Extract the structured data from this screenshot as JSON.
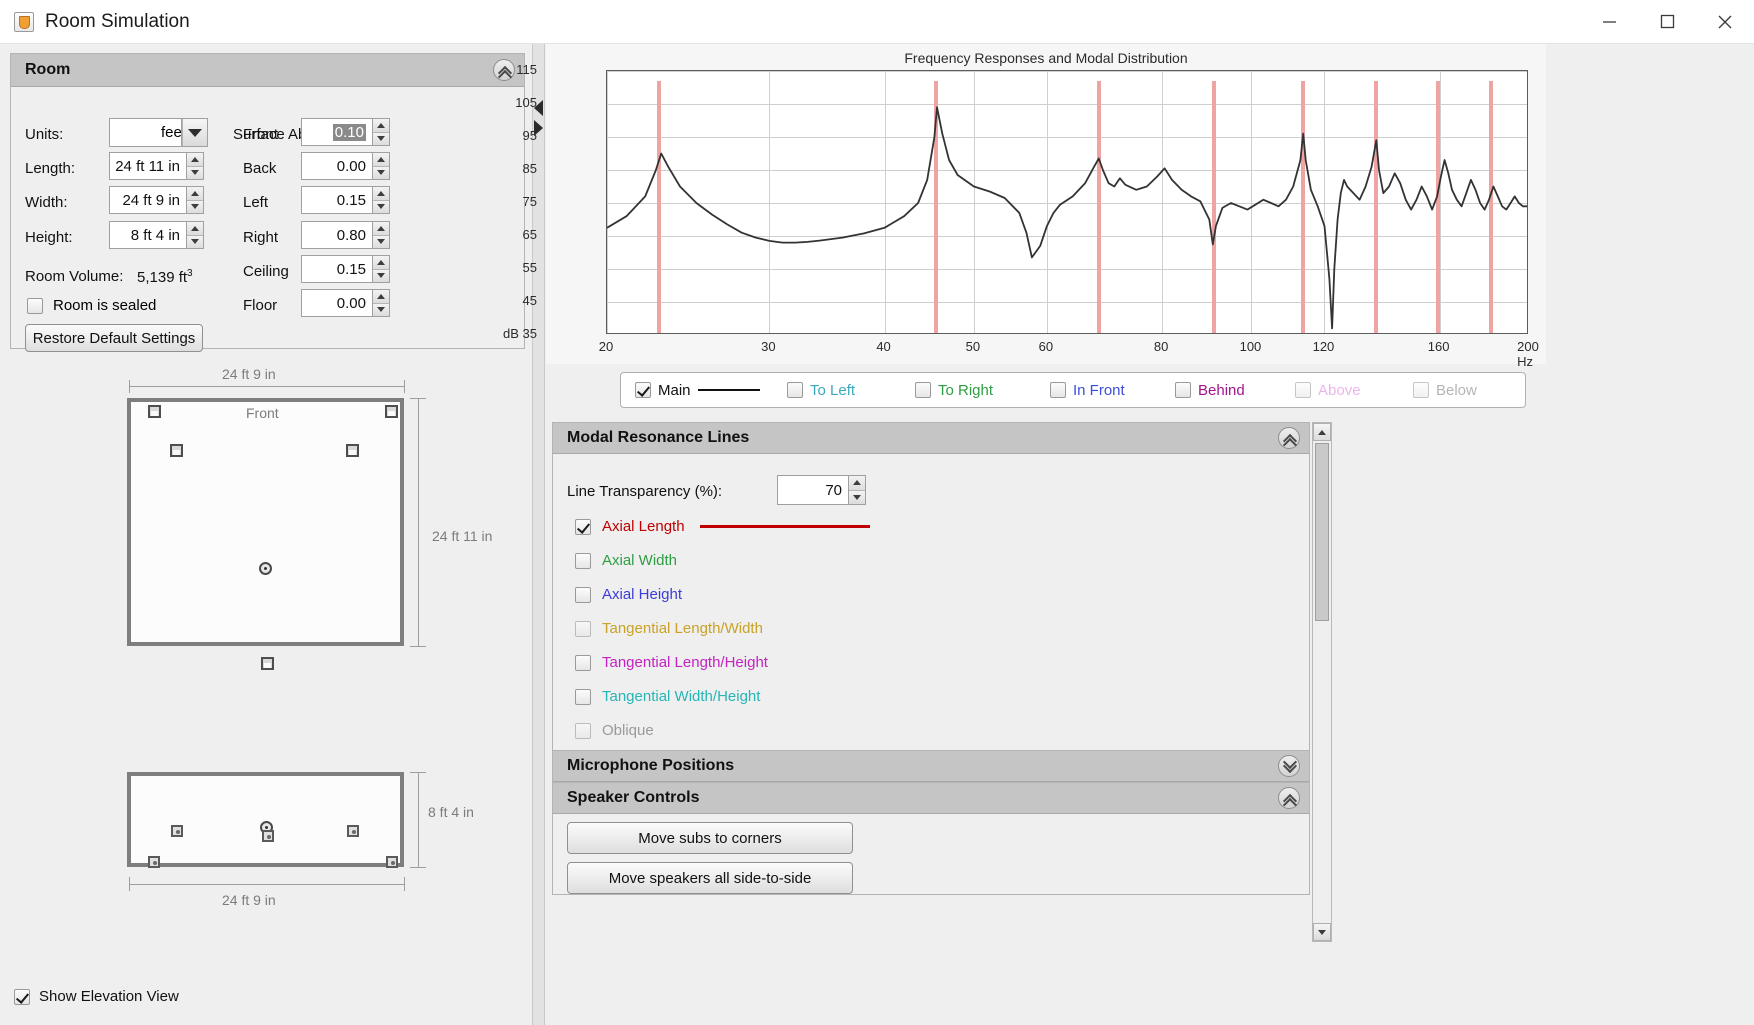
{
  "window": {
    "title": "Room Simulation",
    "icon": "java-coffee-icon",
    "minimize": "minimize-icon",
    "maximize": "maximize-icon",
    "close": "close-icon"
  },
  "room_panel": {
    "title": "Room",
    "collapse_icon": "chevron-up-icon",
    "units_label": "Units:",
    "units_value": "feet",
    "length_label": "Length:",
    "length_value": "24 ft 11 in",
    "width_label": "Width:",
    "width_value": "24 ft 9 in",
    "height_label": "Height:",
    "height_value": "8 ft 4 in",
    "volume_label": "Room Volume:",
    "volume_value": "5,139 ft",
    "volume_exp": "3",
    "sealed_label": "Room is sealed",
    "sealed_checked": false,
    "restore_label": "Restore Default Settings",
    "absorptions_title": "Surface Absorptions",
    "absorptions": [
      {
        "label": "Front",
        "value": "0.10",
        "selected": true
      },
      {
        "label": "Back",
        "value": "0.00",
        "selected": false
      },
      {
        "label": "Left",
        "value": "0.15",
        "selected": false
      },
      {
        "label": "Right",
        "value": "0.80",
        "selected": false
      },
      {
        "label": "Ceiling",
        "value": "0.15",
        "selected": false
      },
      {
        "label": "Floor",
        "value": "0.00",
        "selected": false
      }
    ]
  },
  "room_views": {
    "plan_top_dim": "24 ft 9 in",
    "plan_right_dim": "24 ft 11 in",
    "front_label": "Front",
    "elev_right_dim": "8 ft 4 in",
    "elev_bottom_dim": "24 ft 9 in",
    "show_elevation_label": "Show Elevation View",
    "show_elevation_checked": true
  },
  "chart_data": {
    "type": "line",
    "title": "Frequency Responses and Modal Distribution",
    "xlabel": "Hz",
    "ylabel": "dB",
    "xscale": "log",
    "xlim": [
      20,
      200
    ],
    "ylim": [
      35,
      115
    ],
    "yticks": [
      115,
      105,
      95,
      85,
      75,
      65,
      55,
      45,
      35
    ],
    "ytick_labels": [
      "115",
      "105",
      "95",
      "85",
      "75",
      "65",
      "55",
      "45",
      "dB 35"
    ],
    "xticks": [
      20,
      30,
      40,
      50,
      60,
      80,
      100,
      120,
      160,
      200
    ],
    "xtick_labels": [
      "20",
      "30",
      "40",
      "50",
      "60",
      "80",
      "100",
      "120",
      "160",
      "200 Hz"
    ],
    "grid": true,
    "legend_position": "below",
    "modal_lines_label": "Axial Length resonances",
    "modal_lines_color": "#f0a3a3",
    "modal_lines_hz": [
      22.8,
      45.5,
      68.3,
      91.0,
      113.8,
      136.6,
      159.3,
      182.1
    ],
    "series": [
      {
        "name": "Main",
        "color": "#333333",
        "points_hz_db": [
          [
            20,
            67.5
          ],
          [
            21,
            71
          ],
          [
            22,
            77
          ],
          [
            22.6,
            85
          ],
          [
            22.9,
            90
          ],
          [
            23.3,
            86
          ],
          [
            24,
            80
          ],
          [
            25,
            75
          ],
          [
            26,
            71.5
          ],
          [
            27,
            68.5
          ],
          [
            28,
            66
          ],
          [
            29,
            64.5
          ],
          [
            30,
            63.5
          ],
          [
            31,
            63
          ],
          [
            32,
            63
          ],
          [
            33,
            63.2
          ],
          [
            34,
            63.6
          ],
          [
            36,
            64.5
          ],
          [
            38,
            65.8
          ],
          [
            40,
            67.5
          ],
          [
            42,
            71
          ],
          [
            43.5,
            75
          ],
          [
            44.5,
            82
          ],
          [
            45.3,
            95
          ],
          [
            45.6,
            104
          ],
          [
            46.2,
            96
          ],
          [
            47,
            88
          ],
          [
            48,
            83.5
          ],
          [
            50,
            80
          ],
          [
            52,
            78.5
          ],
          [
            54,
            76.5
          ],
          [
            56,
            72
          ],
          [
            57,
            66
          ],
          [
            57.8,
            58.5
          ],
          [
            59,
            62
          ],
          [
            60,
            68
          ],
          [
            61,
            72
          ],
          [
            62,
            74.5
          ],
          [
            64,
            77
          ],
          [
            66,
            81
          ],
          [
            67.5,
            86
          ],
          [
            68.3,
            88.5
          ],
          [
            69,
            85
          ],
          [
            70,
            81
          ],
          [
            71,
            80
          ],
          [
            72,
            82.5
          ],
          [
            73,
            80.5
          ],
          [
            75,
            79
          ],
          [
            77,
            80
          ],
          [
            79,
            83
          ],
          [
            80.5,
            85.5
          ],
          [
            82,
            82
          ],
          [
            84,
            79
          ],
          [
            86,
            77
          ],
          [
            88,
            75.5
          ],
          [
            90,
            70
          ],
          [
            90.8,
            62.5
          ],
          [
            91.5,
            68
          ],
          [
            93,
            73.5
          ],
          [
            95,
            75
          ],
          [
            97,
            74
          ],
          [
            99,
            73
          ],
          [
            101,
            74.5
          ],
          [
            103,
            76
          ],
          [
            105,
            75
          ],
          [
            107,
            74
          ],
          [
            109,
            76
          ],
          [
            111,
            80
          ],
          [
            113,
            88
          ],
          [
            113.8,
            96
          ],
          [
            114.5,
            88
          ],
          [
            116,
            79
          ],
          [
            118,
            74
          ],
          [
            120,
            68
          ],
          [
            121.5,
            52
          ],
          [
            122.3,
            37
          ],
          [
            123,
            55
          ],
          [
            124,
            70
          ],
          [
            125,
            78
          ],
          [
            126,
            82
          ],
          [
            127,
            80
          ],
          [
            129,
            78
          ],
          [
            131,
            76
          ],
          [
            133,
            80
          ],
          [
            135,
            86
          ],
          [
            136.6,
            94
          ],
          [
            137.5,
            85
          ],
          [
            139,
            78
          ],
          [
            141,
            80
          ],
          [
            143,
            84
          ],
          [
            145,
            81
          ],
          [
            147,
            76
          ],
          [
            149,
            73
          ],
          [
            151,
            76
          ],
          [
            153,
            80
          ],
          [
            155,
            77
          ],
          [
            157,
            73
          ],
          [
            159,
            77
          ],
          [
            160.5,
            83
          ],
          [
            162,
            88
          ],
          [
            163.5,
            84
          ],
          [
            165,
            79
          ],
          [
            167,
            76
          ],
          [
            169,
            74
          ],
          [
            171,
            78
          ],
          [
            173,
            82
          ],
          [
            175,
            79
          ],
          [
            177,
            75
          ],
          [
            179,
            73
          ],
          [
            181,
            76
          ],
          [
            183,
            80
          ],
          [
            185,
            77
          ],
          [
            187,
            74
          ],
          [
            189,
            73
          ],
          [
            191,
            75
          ],
          [
            193,
            77
          ],
          [
            195,
            75
          ],
          [
            197,
            74
          ],
          [
            200,
            74
          ]
        ]
      }
    ],
    "legend": [
      {
        "label": "Main",
        "checked": true,
        "color": "#111111",
        "enabled": true,
        "has_line": true
      },
      {
        "label": "To Left",
        "checked": false,
        "color": "#3aa9bd",
        "enabled": true,
        "has_line": false
      },
      {
        "label": "To Right",
        "checked": false,
        "color": "#2e9e44",
        "enabled": true,
        "has_line": false
      },
      {
        "label": "In Front",
        "checked": false,
        "color": "#3c4fd8",
        "enabled": true,
        "has_line": false
      },
      {
        "label": "Behind",
        "checked": false,
        "color": "#a3148c",
        "enabled": true,
        "has_line": false
      },
      {
        "label": "Above",
        "checked": false,
        "color": "#e6a0e6",
        "enabled": false,
        "has_line": false
      },
      {
        "label": "Below",
        "checked": false,
        "color": "#a8a8a8",
        "enabled": false,
        "has_line": false
      }
    ]
  },
  "modal_panel": {
    "title": "Modal Resonance Lines",
    "collapse_icon": "chevron-up-icon",
    "transparency_label": "Line Transparency (%):",
    "transparency_value": "70",
    "items": [
      {
        "label": "Axial Length",
        "color": "#c00000",
        "checked": true,
        "enabled": true,
        "line": true
      },
      {
        "label": "Axial Width",
        "color": "#2e9e44",
        "checked": false,
        "enabled": true,
        "line": false
      },
      {
        "label": "Axial Height",
        "color": "#3c3cd8",
        "checked": false,
        "enabled": true,
        "line": false
      },
      {
        "label": "Tangential Length/Width",
        "color": "#c9a227",
        "checked": false,
        "enabled": false,
        "line": false
      },
      {
        "label": "Tangential Length/Height",
        "color": "#c223c2",
        "checked": false,
        "enabled": true,
        "line": false
      },
      {
        "label": "Tangential Width/Height",
        "color": "#27b5b5",
        "checked": false,
        "enabled": true,
        "line": false
      },
      {
        "label": "Oblique",
        "color": "#9a9a9a",
        "checked": false,
        "enabled": false,
        "line": false
      }
    ]
  },
  "mic_panel": {
    "title": "Microphone Positions",
    "collapse_icon": "chevron-down-icon"
  },
  "speaker_panel": {
    "title": "Speaker Controls",
    "collapse_icon": "chevron-up-icon",
    "buttons": [
      {
        "label": "Move subs to corners"
      },
      {
        "label": "Move speakers all side-to-side"
      }
    ]
  }
}
